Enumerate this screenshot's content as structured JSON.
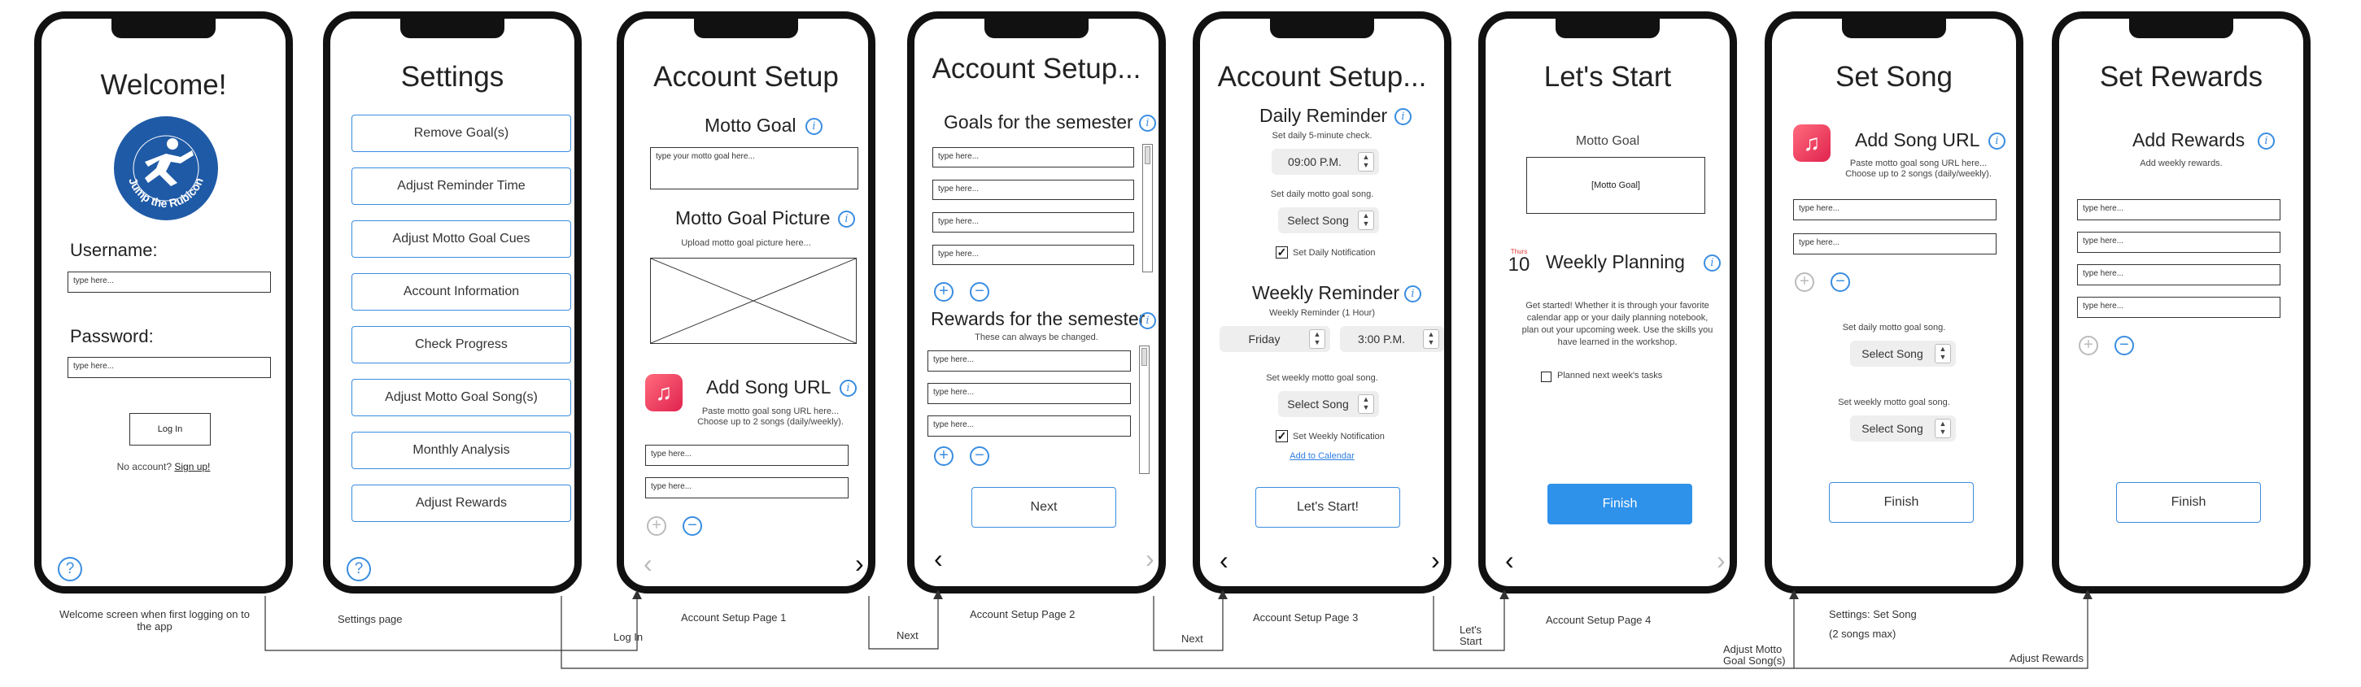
{
  "screens": {
    "welcome": {
      "title": "Welcome!",
      "logo_text": "Jump the Rubicon",
      "username_label": "Username:",
      "username_placeholder": "type here...",
      "password_label": "Password:",
      "password_placeholder": "type here...",
      "login_button": "Log In",
      "no_account": "No account?",
      "signup_link": "Sign up!",
      "help_icon": "?"
    },
    "settings": {
      "title": "Settings",
      "items": [
        "Remove Goal(s)",
        "Adjust Reminder Time",
        "Adjust Motto Goal Cues",
        "Account Information",
        "Check Progress",
        "Adjust Motto Goal Song(s)",
        "Monthly Analysis",
        "Adjust Rewards"
      ],
      "help_icon": "?"
    },
    "setup1": {
      "title": "Account Setup",
      "motto_goal": "Motto Goal",
      "motto_placeholder": "type your motto goal here...",
      "motto_picture": "Motto Goal Picture",
      "upload_hint": "Upload motto goal picture here...",
      "add_song": "Add Song URL",
      "song_hint_1": "Paste motto goal song URL here...",
      "song_hint_2": "Choose up to 2 songs (daily/weekly).",
      "song_placeholder_1": "type here...",
      "song_placeholder_2": "type here..."
    },
    "setup2": {
      "title": "Account Setup...",
      "goals_heading": "Goals for the semester",
      "goal_placeholders": [
        "type here...",
        "type here...",
        "type here...",
        "type here..."
      ],
      "rewards_heading": "Rewards for the semester",
      "rewards_hint": "These can always be changed.",
      "reward_placeholders": [
        "type here...",
        "type here...",
        "type here..."
      ],
      "next_button": "Next"
    },
    "setup3": {
      "title": "Account Setup...",
      "daily_heading": "Daily Reminder",
      "daily_hint": "Set daily 5-minute check.",
      "daily_time": "09:00 P.M.",
      "daily_song_hint": "Set daily motto goal song.",
      "select_song": "Select Song",
      "daily_notification": "Set Daily Notification",
      "weekly_heading": "Weekly Reminder",
      "weekly_hint": "Weekly Reminder (1 Hour)",
      "weekly_day": "Friday",
      "weekly_time": "3:00 P.M.",
      "weekly_song_hint": "Set weekly motto goal song.",
      "weekly_select_song": "Select Song",
      "weekly_notification": "Set Weekly Notification",
      "calendar_link": "Add to Calendar",
      "start_button": "Let's Start!"
    },
    "start": {
      "title": "Let's Start",
      "motto_label": "Motto Goal",
      "motto_box": "[Motto Goal]",
      "calendar_month": "Thurs",
      "calendar_day": "10",
      "planning_heading": "Weekly Planning",
      "planning_text": "Get started! Whether it is through your favorite calendar app or your daily planning notebook, plan out your upcoming week. Use the skills you have learned in the workshop.",
      "planned_label": "Planned next week's tasks",
      "finish_button": "Finish"
    },
    "set_song": {
      "title": "Set Song",
      "add_song": "Add Song URL",
      "hint_1": "Paste motto goal song URL here...",
      "hint_2": "Choose up to 2 songs (daily/weekly).",
      "placeholder_1": "type here...",
      "placeholder_2": "type here...",
      "daily_hint": "Set daily motto goal song.",
      "daily_select": "Select Song",
      "weekly_hint": "Set weekly motto goal song.",
      "weekly_select": "Select Song",
      "finish_button": "Finish"
    },
    "set_rewards": {
      "title": "Set Rewards",
      "add_rewards": "Add Rewards",
      "hint": "Add weekly rewards.",
      "placeholders": [
        "type here...",
        "type here...",
        "type here...",
        "type here..."
      ],
      "finish_button": "Finish"
    }
  },
  "captions": {
    "welcome": "Welcome screen when first logging on to the app",
    "settings": "Settings page",
    "setup1": "Account Setup Page 1",
    "setup2": "Account Setup Page 2",
    "setup3": "Account Setup Page 3",
    "setup4": "Account Setup Page 4",
    "set_song_1": "Settings: Set Song",
    "set_song_2": "(2 songs max)"
  },
  "arrows": {
    "login": "Log In",
    "next1": "Next",
    "next2": "Next",
    "lets_start_1": "Let's",
    "lets_start_2": "Start",
    "adjust_song_1": "Adjust Motto",
    "adjust_song_2": "Goal Song(s)",
    "adjust_rewards": "Adjust Rewards"
  },
  "icons": {
    "info": "info-icon",
    "plus": "+",
    "minus": "−",
    "chevron_left": "‹",
    "chevron_right": "›",
    "checkmark": "✓",
    "music": "♫"
  },
  "colors": {
    "accent": "#2e91ea",
    "outline": "#3a8de0",
    "frame": "#111111"
  }
}
